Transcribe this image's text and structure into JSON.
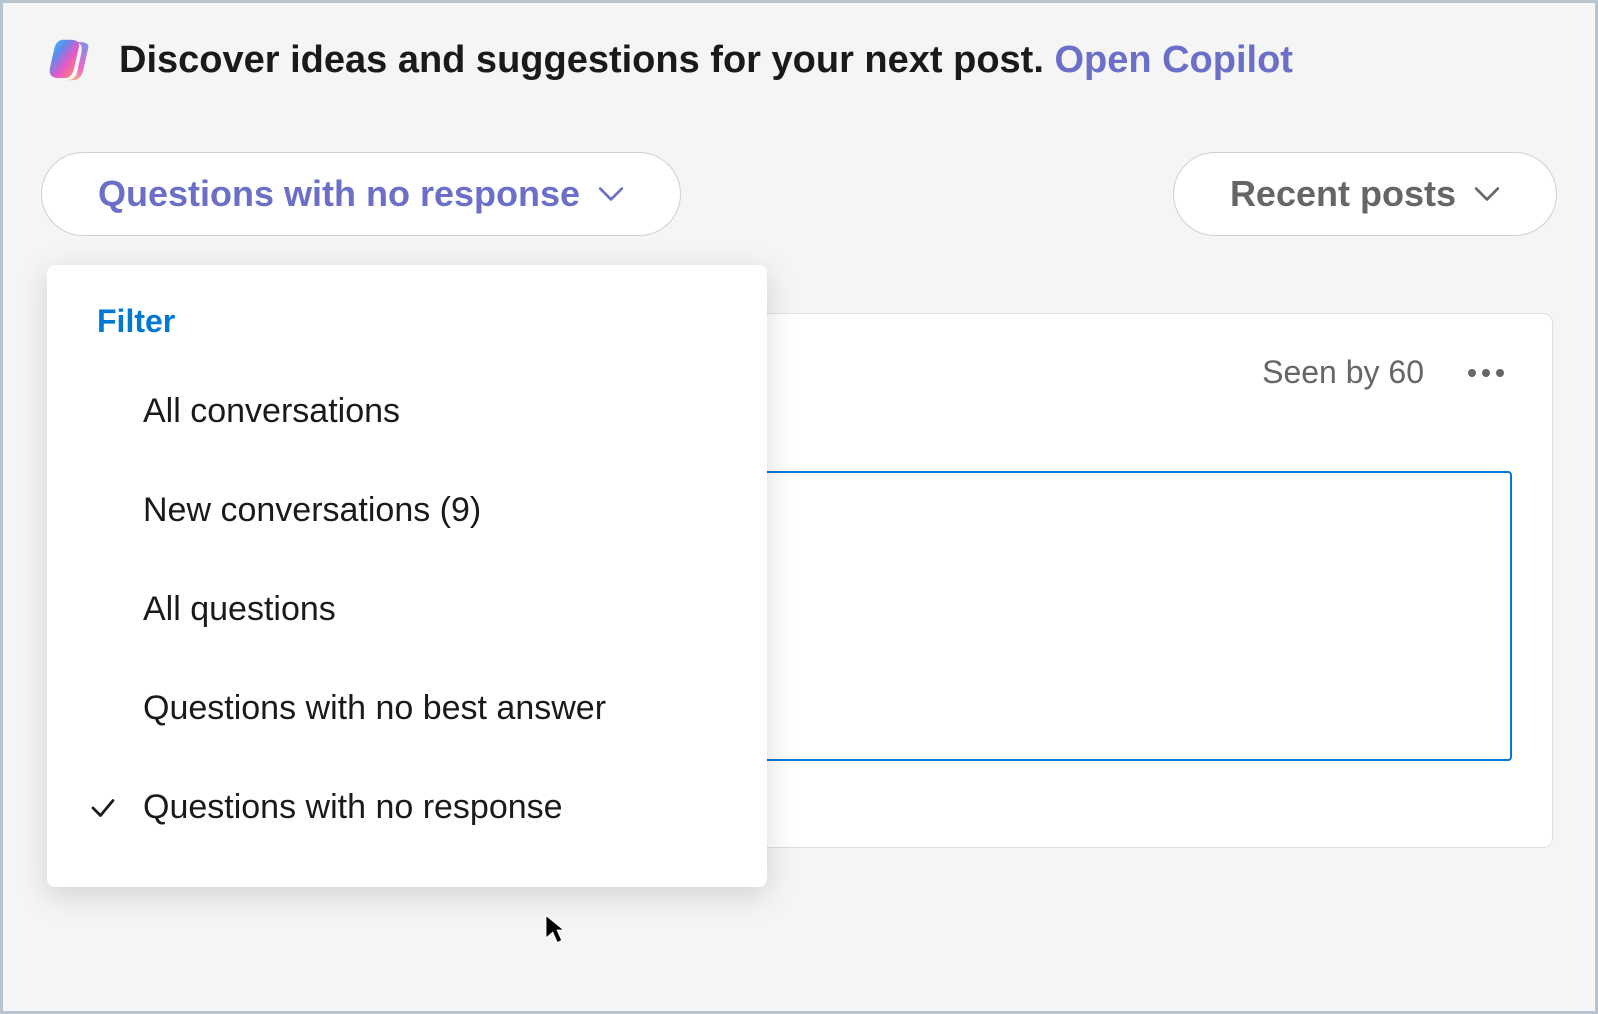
{
  "banner": {
    "text_main": "Discover ideas and suggestions for your next post. ",
    "link_label": "Open Copilot"
  },
  "filters": {
    "primary_selected": "Questions with no response",
    "secondary_selected": "Recent posts"
  },
  "dropdown": {
    "header": "Filter",
    "items": [
      {
        "label": "All conversations",
        "selected": false
      },
      {
        "label": "New conversations (9)",
        "selected": false
      },
      {
        "label": "All questions",
        "selected": false
      },
      {
        "label": "Questions with no best answer",
        "selected": false
      },
      {
        "label": "Questions with no response",
        "selected": true
      }
    ]
  },
  "post": {
    "seen_by_label": "Seen by 60"
  }
}
